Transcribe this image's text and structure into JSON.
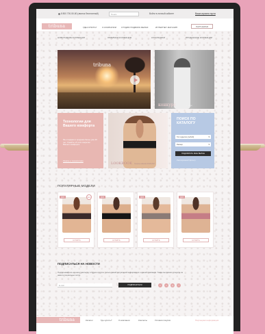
{
  "topbar": {
    "phone": "8 800 700-50-80 (звонок бесплатный)",
    "search_placeholder": "Поиск",
    "login": "Войти в личный кабинет",
    "cart": "Ваша корзина пуста"
  },
  "header": {
    "logo": "tribuna",
    "nav": [
      "ГДЕ КУПИТЬ?",
      "О КОМПАНИИ",
      "СТУДИЯ ПОДБОРА БЕЛЬЯ",
      "ИНТЕРНЕТ-МАГАЗИН"
    ],
    "partners_button": "ПАРТНЕРАМ"
  },
  "categories": [
    "НОВОГОДНИЕ КОЛЛЕКЦИИ",
    "ЛЮБИМАЯ КОЛЛЕКЦИЯ",
    "КУПАЛЬНИКИ",
    "ПРОДАЖНЫЕ КОЛЛЕКЦИИ"
  ],
  "hero": {
    "brand": "tribuna"
  },
  "contest": {
    "label": "конкурс",
    "sub": "фотоконкурс"
  },
  "tech": {
    "title": "Технологии для Вашего комфорта",
    "text": "Мы создаем и продаем белье уже 20 лет. Узнайте об этих секретах Вашего комфорта",
    "more": "Узнать о технологиях"
  },
  "lookbook": {
    "label": "LOOKBOOK",
    "sub": "Лучшие новинки 2016-2017"
  },
  "catalog": {
    "title": "ПОИСК ПО КАТАЛОГУ",
    "select1": "Тип изделия (любой)",
    "select2": "Размер",
    "button": "ПОДОБРАТЬ МНЕ БЕЛЬЕ",
    "advanced": "Расширенный фильтр"
  },
  "popular": {
    "title": "ПОПУЛЯРНЫЕ МОДЕЛИ",
    "products": [
      {
        "tag": "ХИТ",
        "round": "NEW",
        "buy": "КУПИТЬ"
      },
      {
        "tag": "ХИТ",
        "round": "",
        "buy": "КУПИТЬ"
      },
      {
        "tag": "ХИТ",
        "round": "",
        "buy": "КУПИТЬ"
      },
      {
        "tag": "ХИТ",
        "round": "",
        "buy": "КУПИТЬ"
      }
    ]
  },
  "newsletter": {
    "title": "ПОДПИСАТЬСЯ НА НОВОСТИ",
    "text": "Подписывайтесь на нашу рассылку и будьте в курсе только самой актуальной информации о нашей компании. Также вы можете следить за нами в социальных сетях.",
    "email_placeholder": "E-mail",
    "button": "ПОДПИСАТЬСЯ",
    "social": [
      "vk-icon",
      "ok-icon",
      "instagram-icon",
      "facebook-icon"
    ]
  },
  "footer": {
    "logo": "tribuna",
    "nav": [
      "Каталог",
      "Где купить?",
      "О компании",
      "Контакты",
      "Условия покупки"
    ],
    "partners": "Партнерам информация"
  }
}
